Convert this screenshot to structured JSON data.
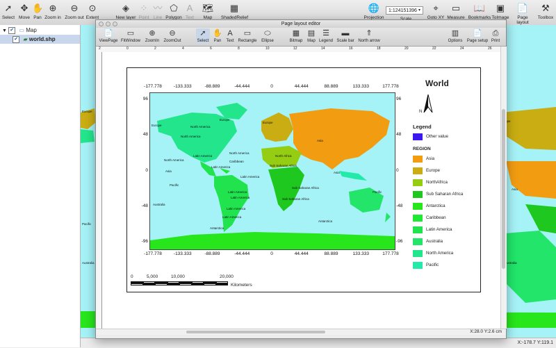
{
  "main_toolbar": {
    "tools": [
      {
        "label": "Select",
        "icon": "arrow-icon"
      },
      {
        "label": "Move",
        "icon": "move-icon"
      },
      {
        "label": "Pan",
        "icon": "hand-icon"
      },
      {
        "label": "Zoom in",
        "icon": "zoom-in-icon"
      },
      {
        "label": "Zoom out",
        "icon": "zoom-out-icon"
      },
      {
        "label": "Extent",
        "icon": "extent-icon"
      },
      {
        "label": "New layer",
        "icon": "new-layer-icon"
      },
      {
        "label": "Point",
        "icon": "point-icon"
      },
      {
        "label": "Line",
        "icon": "line-icon"
      },
      {
        "label": "Polygon",
        "icon": "polygon-icon"
      },
      {
        "label": "Text",
        "icon": "text-icon"
      },
      {
        "label": "Map",
        "icon": "map-icon"
      },
      {
        "label": "ShadedRelief",
        "icon": "shaded-relief-icon"
      }
    ],
    "projection_label": "Projection",
    "scale_value": "1:124151396",
    "scale_label": "Scale",
    "right_tools": [
      {
        "label": "Goto XY",
        "icon": "goto-xy-icon"
      },
      {
        "label": "Measure",
        "icon": "measure-icon"
      },
      {
        "label": "Bookmarks",
        "icon": "bookmarks-icon"
      },
      {
        "label": "ToImage",
        "icon": "to-image-icon"
      },
      {
        "label": "Page layout",
        "icon": "page-layout-icon"
      },
      {
        "label": "Toolbox",
        "icon": "toolbox-icon"
      }
    ]
  },
  "layers": {
    "group": "Map",
    "layer": "world.shp"
  },
  "page_layout": {
    "title": "Page layout editor",
    "tools": [
      {
        "label": "ViewPage",
        "icon": "view-page-icon"
      },
      {
        "label": "FitWindow",
        "icon": "fit-window-icon"
      },
      {
        "label": "ZoomIn",
        "icon": "zoom-in-icon"
      },
      {
        "label": "ZoomOut",
        "icon": "zoom-out-icon"
      },
      {
        "label": "Select",
        "icon": "arrow-icon"
      },
      {
        "label": "Pan",
        "icon": "hand-icon"
      },
      {
        "label": "Text",
        "icon": "text-icon"
      },
      {
        "label": "Rectangle",
        "icon": "rectangle-icon"
      },
      {
        "label": "Ellipse",
        "icon": "ellipse-icon"
      },
      {
        "label": "Bitmap",
        "icon": "bitmap-icon"
      },
      {
        "label": "Map",
        "icon": "map-icon"
      },
      {
        "label": "Legend",
        "icon": "legend-icon"
      },
      {
        "label": "Scale bar",
        "icon": "scale-bar-icon"
      },
      {
        "label": "North arrow",
        "icon": "north-arrow-icon"
      },
      {
        "label": "Options",
        "icon": "options-icon"
      },
      {
        "label": "Page setup",
        "icon": "page-setup-icon"
      },
      {
        "label": "Print",
        "icon": "print-icon"
      }
    ],
    "ruler_top": [
      "2",
      "0",
      "2",
      "4",
      "6",
      "8",
      "10",
      "12",
      "14",
      "16",
      "18",
      "20",
      "22",
      "24",
      "26"
    ],
    "status": "X:28.0 Y:2.6 cm"
  },
  "map": {
    "x_ticks": [
      "-177.778",
      "-133.333",
      "-88.889",
      "-44.444",
      "0",
      "44.444",
      "88.889",
      "133.333",
      "177.778"
    ],
    "y_ticks": [
      "96",
      "48",
      "0",
      "-48",
      "-96"
    ],
    "labels": [
      "Europe",
      "Asia",
      "Europe",
      "Europe",
      "North America",
      "North America",
      "North America",
      "North Africa",
      "North America",
      "Latin America",
      "Latin America",
      "Caribbean",
      "Asia",
      "Asia",
      "Latin America",
      "Sub Saharan Africa",
      "Sub Saharan Africa",
      "Pacific",
      "Latin America",
      "Latin America",
      "Sub Saharan Africa",
      "Australia",
      "Latin America",
      "Latin America",
      "Antarctica",
      "Antarctica",
      "Pacific"
    ],
    "title": "World",
    "legend_title": "Legend",
    "other_value": "Other value",
    "region_title": "REGION",
    "regions": [
      {
        "name": "Asia",
        "color": "#f29c12"
      },
      {
        "name": "Europe",
        "color": "#c9ad12"
      },
      {
        "name": "NorthAfrica",
        "color": "#94cd12"
      },
      {
        "name": "Sub Saharan Africa",
        "color": "#1ec81e"
      },
      {
        "name": "Antarctica",
        "color": "#28e61c"
      },
      {
        "name": "Caribbean",
        "color": "#1de832"
      },
      {
        "name": "Latin America",
        "color": "#20e34e"
      },
      {
        "name": "Australia",
        "color": "#22e56a"
      },
      {
        "name": "North America",
        "color": "#23e68c"
      },
      {
        "name": "Pacific",
        "color": "#23eaa8"
      }
    ],
    "other_color": "#3b17f0",
    "scalebar": {
      "ticks": [
        "0",
        "5,000",
        "10,000",
        "20,000"
      ],
      "unit": "Kilometers"
    }
  },
  "background_map": {
    "labels": [
      "Europe",
      "Europe",
      "Asia",
      "Pacific",
      "Australia",
      "Australia",
      "Pacific"
    ],
    "coords": "X:-178.7 Y:119.1"
  }
}
